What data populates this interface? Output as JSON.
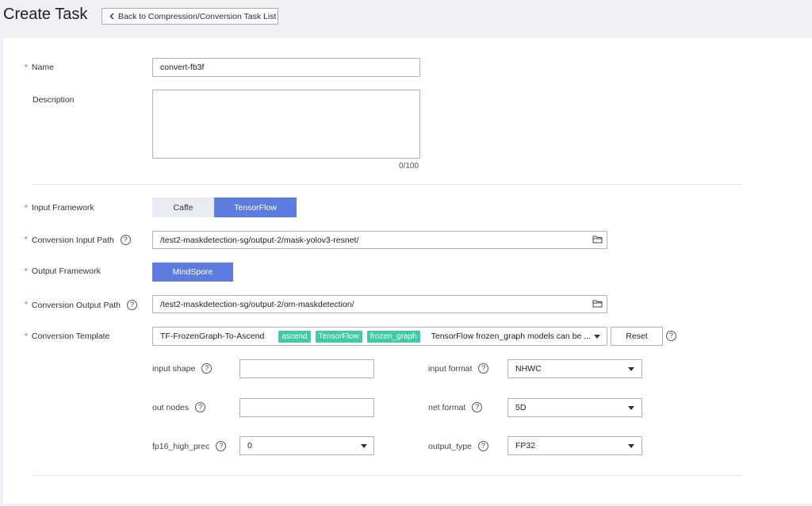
{
  "header": {
    "title": "Create Task",
    "back_button": "Back to Compression/Conversion Task List"
  },
  "form": {
    "name": {
      "label": "Name",
      "value": "convert-fb3f"
    },
    "description": {
      "label": "Description",
      "value": "",
      "counter": "0/100"
    },
    "input_framework": {
      "label": "Input Framework",
      "options": [
        "Caffe",
        "TensorFlow"
      ],
      "selected": "TensorFlow"
    },
    "input_path": {
      "label": "Conversion Input Path",
      "value": "/test2-maskdetection-sg/output-2/mask-yolov3-resnet/"
    },
    "output_framework": {
      "label": "Output Framework",
      "option": "MindSpore"
    },
    "output_path": {
      "label": "Conversion Output Path",
      "value": "/test2-maskdetection-sg/output-2/om-maskdetection/"
    },
    "template": {
      "label": "Conversion Template",
      "value": "TF-FrozenGraph-To-Ascend",
      "tags": [
        "ascend",
        "TensorFlow",
        "frozen_graph"
      ],
      "description": "TensorFlow frozen_graph models can be ...",
      "reset_label": "Reset"
    },
    "params": {
      "input_shape": {
        "label": "input shape",
        "value": ""
      },
      "input_format": {
        "label": "input format",
        "value": "NHWC"
      },
      "out_nodes": {
        "label": "out nodes",
        "value": ""
      },
      "net_format": {
        "label": "net format",
        "value": "5D"
      },
      "fp16_high_prec": {
        "label": "fp16_high_prec",
        "value": "0"
      },
      "output_type": {
        "label": "output_type",
        "value": "FP32"
      }
    }
  },
  "colors": {
    "accent": "#5e7ce0",
    "required": "#e54545",
    "tag": "#3dcca6"
  }
}
